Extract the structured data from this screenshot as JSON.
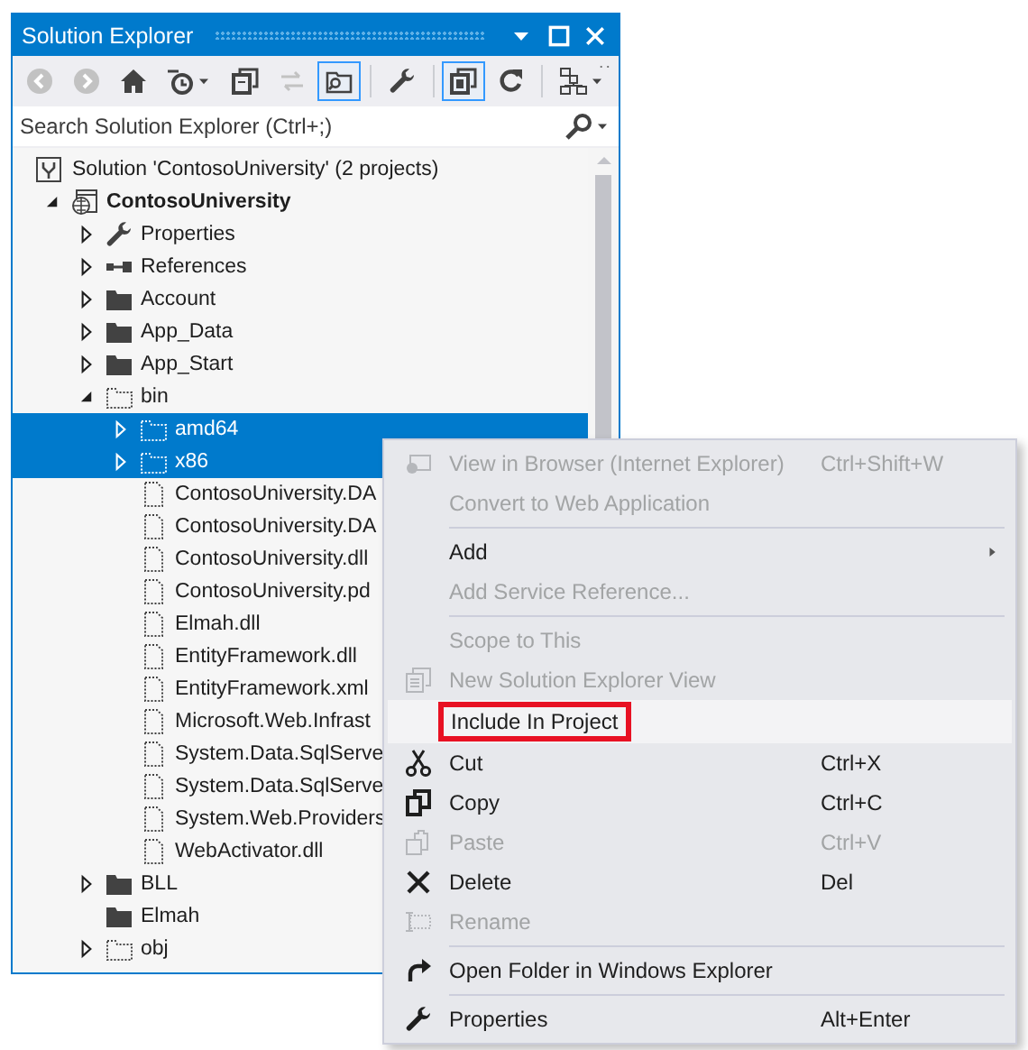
{
  "window": {
    "title": "Solution Explorer"
  },
  "toolbar": [
    {
      "kind": "button",
      "disabled": true,
      "pressed": false
    },
    {
      "kind": "button",
      "disabled": true,
      "pressed": false
    },
    {
      "kind": "button",
      "disabled": false,
      "pressed": false
    },
    {
      "kind": "button",
      "disabled": false,
      "pressed": false,
      "dropdown": true
    },
    {
      "kind": "button",
      "disabled": false,
      "pressed": false
    },
    {
      "kind": "button",
      "disabled": true,
      "pressed": false
    },
    {
      "kind": "button",
      "disabled": false,
      "pressed": true
    },
    {
      "kind": "separator"
    },
    {
      "kind": "button",
      "disabled": false,
      "pressed": false
    },
    {
      "kind": "separator"
    },
    {
      "kind": "button",
      "disabled": false,
      "pressed": true
    },
    {
      "kind": "button",
      "disabled": false,
      "pressed": false
    },
    {
      "kind": "separator"
    },
    {
      "kind": "button",
      "disabled": false,
      "pressed": false,
      "dropdown": true
    }
  ],
  "search": {
    "placeholder": "Search Solution Explorer (Ctrl+;)"
  },
  "solution": {
    "label": "Solution 'ContosoUniversity' (2 projects)"
  },
  "tree": [
    {
      "label": "ContosoUniversity",
      "kind": "project",
      "expanded": true,
      "selected": false,
      "children": [
        {
          "label": "Properties",
          "kind": "properties",
          "expanded": false,
          "selected": false
        },
        {
          "label": "References",
          "kind": "references",
          "expanded": false,
          "selected": false
        },
        {
          "label": "Account",
          "kind": "folder",
          "expanded": false,
          "selected": false
        },
        {
          "label": "App_Data",
          "kind": "folder",
          "expanded": false,
          "selected": false
        },
        {
          "label": "App_Start",
          "kind": "folder",
          "expanded": false,
          "selected": false
        },
        {
          "label": "bin",
          "kind": "hidden-folder",
          "expanded": true,
          "selected": false,
          "children": [
            {
              "label": "amd64",
              "kind": "hidden-folder",
              "expanded": false,
              "selected": true
            },
            {
              "label": "x86",
              "kind": "hidden-folder",
              "expanded": false,
              "selected": true
            },
            {
              "label": "ContosoUniversity.DA",
              "kind": "hidden-file",
              "selected": false
            },
            {
              "label": "ContosoUniversity.DA",
              "kind": "hidden-file",
              "selected": false
            },
            {
              "label": "ContosoUniversity.dll",
              "kind": "hidden-file",
              "selected": false
            },
            {
              "label": "ContosoUniversity.pd",
              "kind": "hidden-file",
              "selected": false
            },
            {
              "label": "Elmah.dll",
              "kind": "hidden-file",
              "selected": false
            },
            {
              "label": "EntityFramework.dll",
              "kind": "hidden-file",
              "selected": false
            },
            {
              "label": "EntityFramework.xml",
              "kind": "hidden-file",
              "selected": false
            },
            {
              "label": "Microsoft.Web.Infrast",
              "kind": "hidden-file",
              "selected": false
            },
            {
              "label": "System.Data.SqlServe",
              "kind": "hidden-file",
              "selected": false
            },
            {
              "label": "System.Data.SqlServe",
              "kind": "hidden-file",
              "selected": false
            },
            {
              "label": "System.Web.Providers",
              "kind": "hidden-file",
              "selected": false
            },
            {
              "label": "WebActivator.dll",
              "kind": "hidden-file",
              "selected": false
            }
          ]
        },
        {
          "label": "BLL",
          "kind": "folder",
          "expanded": false,
          "selected": false
        },
        {
          "label": "Elmah",
          "kind": "folder",
          "selected": false
        },
        {
          "label": "obj",
          "kind": "hidden-folder",
          "expanded": false,
          "selected": false
        }
      ]
    }
  ],
  "context_menu": [
    [
      {
        "label": "View in Browser (Internet Explorer)",
        "shortcut": "Ctrl+Shift+W",
        "disabled": true,
        "selected": false
      },
      {
        "label": "Convert to Web Application",
        "disabled": true,
        "selected": false
      }
    ],
    [
      {
        "label": "Add",
        "disabled": false,
        "submenu": true,
        "selected": false
      },
      {
        "label": "Add Service Reference...",
        "disabled": true,
        "selected": false
      }
    ],
    [
      {
        "label": "Scope to This",
        "disabled": true,
        "selected": false
      },
      {
        "label": "New Solution Explorer View",
        "disabled": true,
        "selected": false
      },
      {
        "label": "Include In Project",
        "disabled": false,
        "selected": true,
        "callout": true
      },
      {
        "label": "Cut",
        "shortcut": "Ctrl+X",
        "disabled": false,
        "selected": false
      },
      {
        "label": "Copy",
        "shortcut": "Ctrl+C",
        "disabled": false,
        "selected": false
      },
      {
        "label": "Paste",
        "shortcut": "Ctrl+V",
        "disabled": true,
        "selected": false
      },
      {
        "label": "Delete",
        "shortcut": "Del",
        "disabled": false,
        "selected": false
      },
      {
        "label": "Rename",
        "disabled": true,
        "selected": false
      }
    ],
    [
      {
        "label": "Open Folder in Windows Explorer",
        "disabled": false,
        "selected": false
      }
    ],
    [
      {
        "label": "Properties",
        "shortcut": "Alt+Enter",
        "disabled": false,
        "selected": false
      }
    ]
  ]
}
